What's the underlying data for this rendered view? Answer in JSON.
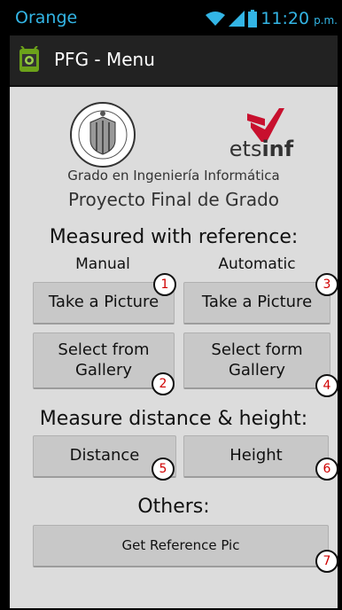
{
  "status_bar": {
    "carrier": "Orange",
    "time": "11:20",
    "ampm": "p.m."
  },
  "action_bar": {
    "title": "PFG - Menu",
    "icon": "android-app-icon"
  },
  "logos": {
    "ets_prefix": "ets",
    "ets_bold": "inf"
  },
  "header": {
    "grado": "Grado en Ingeniería Informática",
    "proyecto": "Proyecto Final de Grado"
  },
  "section_reference": {
    "title": "Measured with reference:",
    "manual_label": "Manual",
    "automatic_label": "Automatic",
    "manual_take": "Take a Picture",
    "manual_gallery_l1": "Select from",
    "manual_gallery_l2": "Gallery",
    "auto_take": "Take a Picture",
    "auto_gallery_l1": "Select form",
    "auto_gallery_l2": "Gallery"
  },
  "section_measure": {
    "title": "Measure distance & height:",
    "distance": "Distance",
    "height": "Height"
  },
  "section_others": {
    "title": "Others:",
    "reference": "Get Reference Pic"
  },
  "badges": [
    "1",
    "2",
    "3",
    "4",
    "5",
    "6",
    "7"
  ],
  "colors": {
    "status_accent": "#33b5e5",
    "badge_number": "#d00000",
    "ets_logo_red": "#c8102e"
  }
}
